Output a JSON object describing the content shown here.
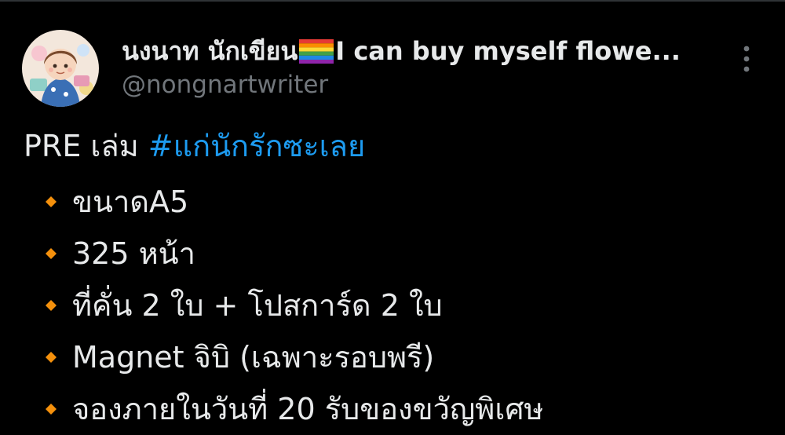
{
  "author": {
    "display_name_part1": "นงนาท นักเขียน",
    "display_name_flag_icon": "rainbow-flag-icon",
    "display_name_part2": "I can buy myself flowe...",
    "handle": "@nongnartwriter",
    "avatar_icon": "avatar-illustration-icon"
  },
  "more_icon": "more-options-icon",
  "tweet": {
    "intro_text": "PRE เล่ม",
    "hashtag": "#แก่นักรักซะเลย",
    "bullet_icon": "small-orange-diamond-icon",
    "items": [
      "ขนาดA5",
      "325 หน้า",
      "ที่คั่น 2 ใบ + โปสการ์ด 2 ใบ",
      "Magnet จิบิ (เฉพาะรอบพรี)",
      "จองภายในวันที่ 20 รับของขวัญพิเศษ"
    ]
  },
  "colors": {
    "background": "#000000",
    "primary_text": "#e7e9ea",
    "secondary_text": "#71767b",
    "link": "#1d9bf0",
    "bullet": "#f4900c"
  }
}
